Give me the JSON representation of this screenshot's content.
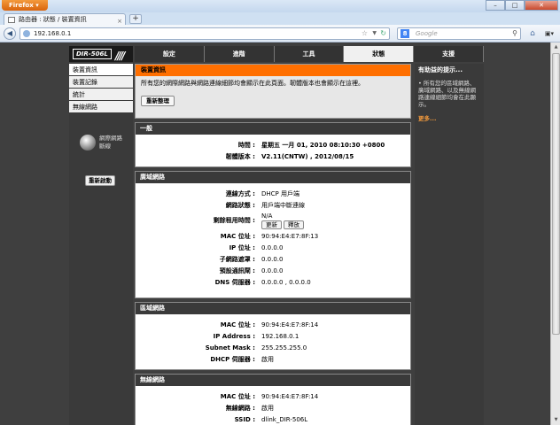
{
  "browser": {
    "app_name": "Firefox",
    "tab_title": "路由器 : 狀態 / 裝置資訊",
    "url": "192.168.0.1",
    "search_placeholder": "Google",
    "search_engine_letter": "8",
    "window_min": "–",
    "window_max": "□",
    "window_close": "✕",
    "new_tab": "+",
    "tab_close": "×",
    "star": "☆",
    "dropdown": "▼",
    "reload": "↻",
    "back": "◀",
    "home": "⌂",
    "menu": "▣▾",
    "search_glyph": "⚲"
  },
  "router": {
    "model": "DIR-506L",
    "stripes": "////",
    "tabs": [
      "設定",
      "進階",
      "工具",
      "狀態",
      "支援"
    ],
    "active_tab_index": 3,
    "sidebar": {
      "items": [
        "裝置資訊",
        "裝置記錄",
        "統計",
        "無線網路"
      ],
      "status_text_line1": "網際網路",
      "status_text_line2": "斷線",
      "reboot_label": "重新啟動"
    },
    "device_info": {
      "title": "裝置資訊",
      "description": "所有您的網際網路與網路連線細節均會顯示在此頁面。韌體版本也會顯示在這裡。",
      "refresh_label": "重新整理"
    },
    "general": {
      "title": "一般",
      "time_label": "時間 :",
      "time_value": "星期五 一月 01, 2010 08:10:30 +0800",
      "firmware_label": "韌體版本 :",
      "firmware_value": "V2.11(CNTW) , 2012/08/15"
    },
    "wan": {
      "title": "廣域網路",
      "rows": [
        {
          "label": "連線方式 :",
          "value": "DHCP 用戶端"
        },
        {
          "label": "網路狀態 :",
          "value": "用戶端中斷連線"
        },
        {
          "label": "剩餘租用時間 :",
          "value": "N/A"
        },
        {
          "label": "MAC 位址 :",
          "value": "90:94:E4:E7:8F:13"
        },
        {
          "label": "IP 位址 :",
          "value": "0.0.0.0"
        },
        {
          "label": "子網路遮罩 :",
          "value": "0.0.0.0"
        },
        {
          "label": "預設通訊閘 :",
          "value": "0.0.0.0"
        },
        {
          "label": "DNS 伺服器 :",
          "value": "0.0.0.0 , 0.0.0.0"
        }
      ],
      "renew_label": "更新",
      "release_label": "釋放"
    },
    "lan": {
      "title": "區域網路",
      "rows": [
        {
          "label": "MAC 位址 :",
          "value": "90:94:E4:E7:8F:14"
        },
        {
          "label": "IP Address :",
          "value": "192.168.0.1"
        },
        {
          "label": "Subnet Mask :",
          "value": "255.255.255.0"
        },
        {
          "label": "DHCP 伺服器 :",
          "value": "啟用"
        }
      ]
    },
    "wlan": {
      "title": "無線網路",
      "rows": [
        {
          "label": "MAC 位址 :",
          "value": "90:94:E4:E7:8F:14"
        },
        {
          "label": "無線網路 :",
          "value": "啟用"
        },
        {
          "label": "SSID :",
          "value": "dlink_DIR-506L"
        }
      ]
    },
    "help": {
      "title": "有助益的提示...",
      "text": "• 所有您的區域網路、廣域網路、以及無線網路連線細節均會在此顯示。",
      "more": "更多..."
    }
  }
}
